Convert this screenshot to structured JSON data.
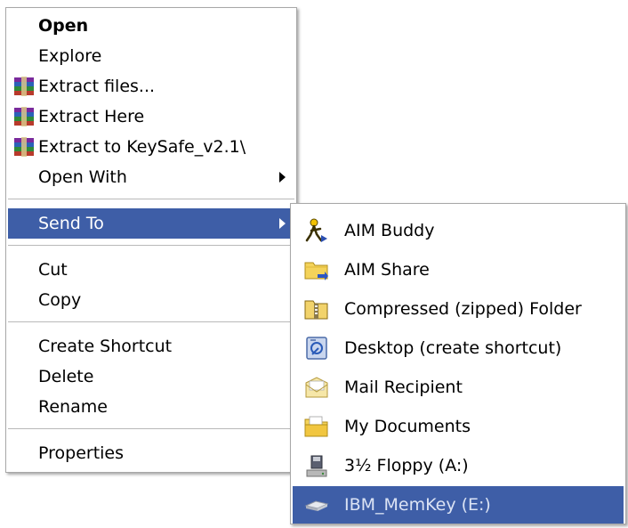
{
  "context_menu": {
    "items": [
      {
        "label": "Open"
      },
      {
        "label": "Explore"
      },
      {
        "label": "Extract files..."
      },
      {
        "label": "Extract Here"
      },
      {
        "label": "Extract to KeySafe_v2.1\\"
      },
      {
        "label": "Open With"
      },
      {
        "label": "Send To"
      },
      {
        "label": "Cut"
      },
      {
        "label": "Copy"
      },
      {
        "label": "Create Shortcut"
      },
      {
        "label": "Delete"
      },
      {
        "label": "Rename"
      },
      {
        "label": "Properties"
      }
    ]
  },
  "send_to_menu": {
    "items": [
      {
        "label": "AIM Buddy",
        "icon": "aim-buddy-icon"
      },
      {
        "label": "AIM Share",
        "icon": "folder-share-icon"
      },
      {
        "label": "Compressed (zipped) Folder",
        "icon": "zip-folder-icon"
      },
      {
        "label": "Desktop (create shortcut)",
        "icon": "desktop-icon"
      },
      {
        "label": "Mail Recipient",
        "icon": "mail-icon"
      },
      {
        "label": "My Documents",
        "icon": "documents-folder-icon"
      },
      {
        "label": "3½ Floppy (A:)",
        "icon": "floppy-drive-icon"
      },
      {
        "label": "IBM_MemKey (E:)",
        "icon": "usb-drive-icon"
      }
    ]
  },
  "colors": {
    "highlight": "#3e5ea7",
    "highlight_text": "#ffffff"
  }
}
